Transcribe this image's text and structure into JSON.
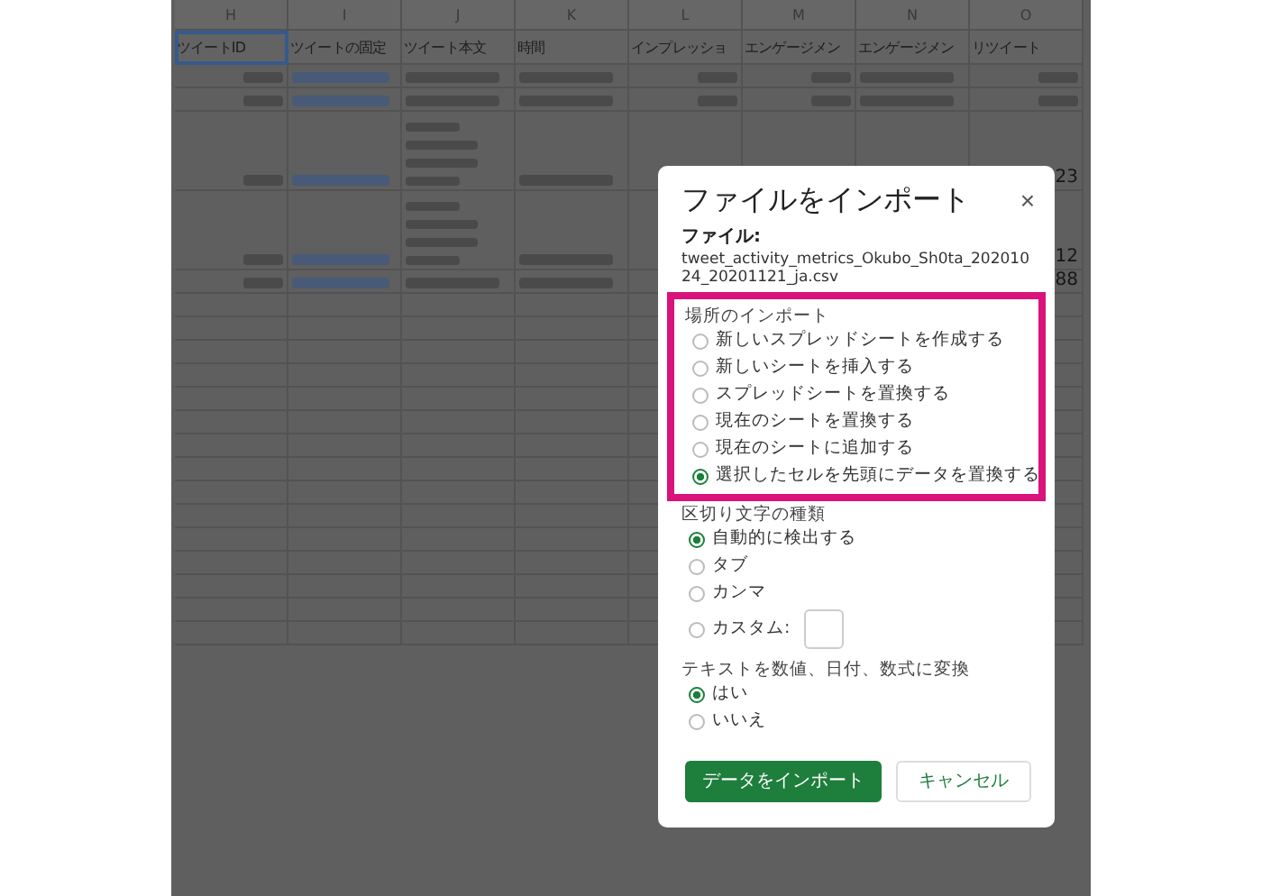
{
  "sheet": {
    "column_letters": [
      "H",
      "I",
      "J",
      "K",
      "L",
      "M",
      "N",
      "O"
    ],
    "header_cells": [
      {
        "text": "ツイートID",
        "selected": true
      },
      {
        "text": "ツイートの固定",
        "selected": false
      },
      {
        "text": "ツイート本文",
        "selected": false
      },
      {
        "text": "時間",
        "selected": false
      },
      {
        "text": "インプレッショ",
        "selected": false
      },
      {
        "text": "エンゲージメン",
        "selected": false
      },
      {
        "text": "エンゲージメン",
        "selected": false
      },
      {
        "text": "リツイート",
        "selected": false
      }
    ],
    "rows": [
      {
        "kind": "normal",
        "cells": [
          {
            "kind": "blurred-number"
          },
          {
            "kind": "blurred-link"
          },
          {
            "kind": "blurred-text"
          },
          {
            "kind": "blurred-text"
          },
          {
            "kind": "blurred-number"
          },
          {
            "kind": "blurred-number"
          },
          {
            "kind": "blurred-text"
          },
          {
            "kind": "blurred-number"
          }
        ]
      },
      {
        "kind": "normal",
        "cells": [
          {
            "kind": "blurred-number"
          },
          {
            "kind": "blurred-link"
          },
          {
            "kind": "blurred-text"
          },
          {
            "kind": "blurred-text"
          },
          {
            "kind": "blurred-number"
          },
          {
            "kind": "blurred-number"
          },
          {
            "kind": "blurred-text"
          },
          {
            "kind": "blurred-number"
          }
        ]
      },
      {
        "kind": "tall",
        "cells": [
          {
            "kind": "blurred-number"
          },
          {
            "kind": "blurred-link"
          },
          {
            "kind": "blurred-block"
          },
          {
            "kind": "blurred-text"
          },
          {
            "kind": "empty"
          },
          {
            "kind": "covered"
          },
          {
            "kind": "covered"
          },
          {
            "kind": "number",
            "text": "23"
          }
        ]
      },
      {
        "kind": "tall",
        "cells": [
          {
            "kind": "blurred-number"
          },
          {
            "kind": "blurred-link"
          },
          {
            "kind": "blurred-block"
          },
          {
            "kind": "blurred-text"
          },
          {
            "kind": "empty"
          },
          {
            "kind": "covered"
          },
          {
            "kind": "covered"
          },
          {
            "kind": "number",
            "text": "12"
          }
        ]
      },
      {
        "kind": "normal",
        "cells": [
          {
            "kind": "blurred-number"
          },
          {
            "kind": "blurred-link"
          },
          {
            "kind": "blurred-text"
          },
          {
            "kind": "blurred-text"
          },
          {
            "kind": "empty"
          },
          {
            "kind": "covered"
          },
          {
            "kind": "covered"
          },
          {
            "kind": "number",
            "text": "88"
          }
        ]
      }
    ]
  },
  "dialog": {
    "title": "ファイルをインポート",
    "close": "×",
    "file_label": "ファイル:",
    "file_name": "tweet_activity_metrics_Okubo_Sh0ta_20201024_20201121_ja.csv",
    "sections": [
      {
        "title": "場所のインポート",
        "highlighted": true,
        "options": [
          {
            "kind": "radio",
            "label": "新しいスプレッドシートを作成する",
            "selected": false
          },
          {
            "kind": "radio",
            "label": "新しいシートを挿入する",
            "selected": false
          },
          {
            "kind": "radio",
            "label": "スプレッドシートを置換する",
            "selected": false
          },
          {
            "kind": "radio",
            "label": "現在のシートを置換する",
            "selected": false
          },
          {
            "kind": "radio",
            "label": "現在のシートに追加する",
            "selected": false
          },
          {
            "kind": "radio",
            "label": "選択したセルを先頭にデータを置換する",
            "selected": true
          }
        ]
      },
      {
        "title": "区切り文字の種類",
        "highlighted": false,
        "options": [
          {
            "kind": "radio",
            "label": "自動的に検出する",
            "selected": true
          },
          {
            "kind": "radio",
            "label": "タブ",
            "selected": false
          },
          {
            "kind": "radio",
            "label": "カンマ",
            "selected": false
          },
          {
            "kind": "custom",
            "label": "カスタム:",
            "selected": false
          }
        ]
      },
      {
        "title": "テキストを数値、日付、数式に変換",
        "highlighted": false,
        "options": [
          {
            "kind": "radio",
            "label": "はい",
            "selected": true
          },
          {
            "kind": "radio",
            "label": "いいえ",
            "selected": false
          }
        ]
      }
    ],
    "buttons": [
      {
        "kind": "primary",
        "label": "データをインポート"
      },
      {
        "kind": "secondary",
        "label": "キャンセル"
      }
    ]
  }
}
